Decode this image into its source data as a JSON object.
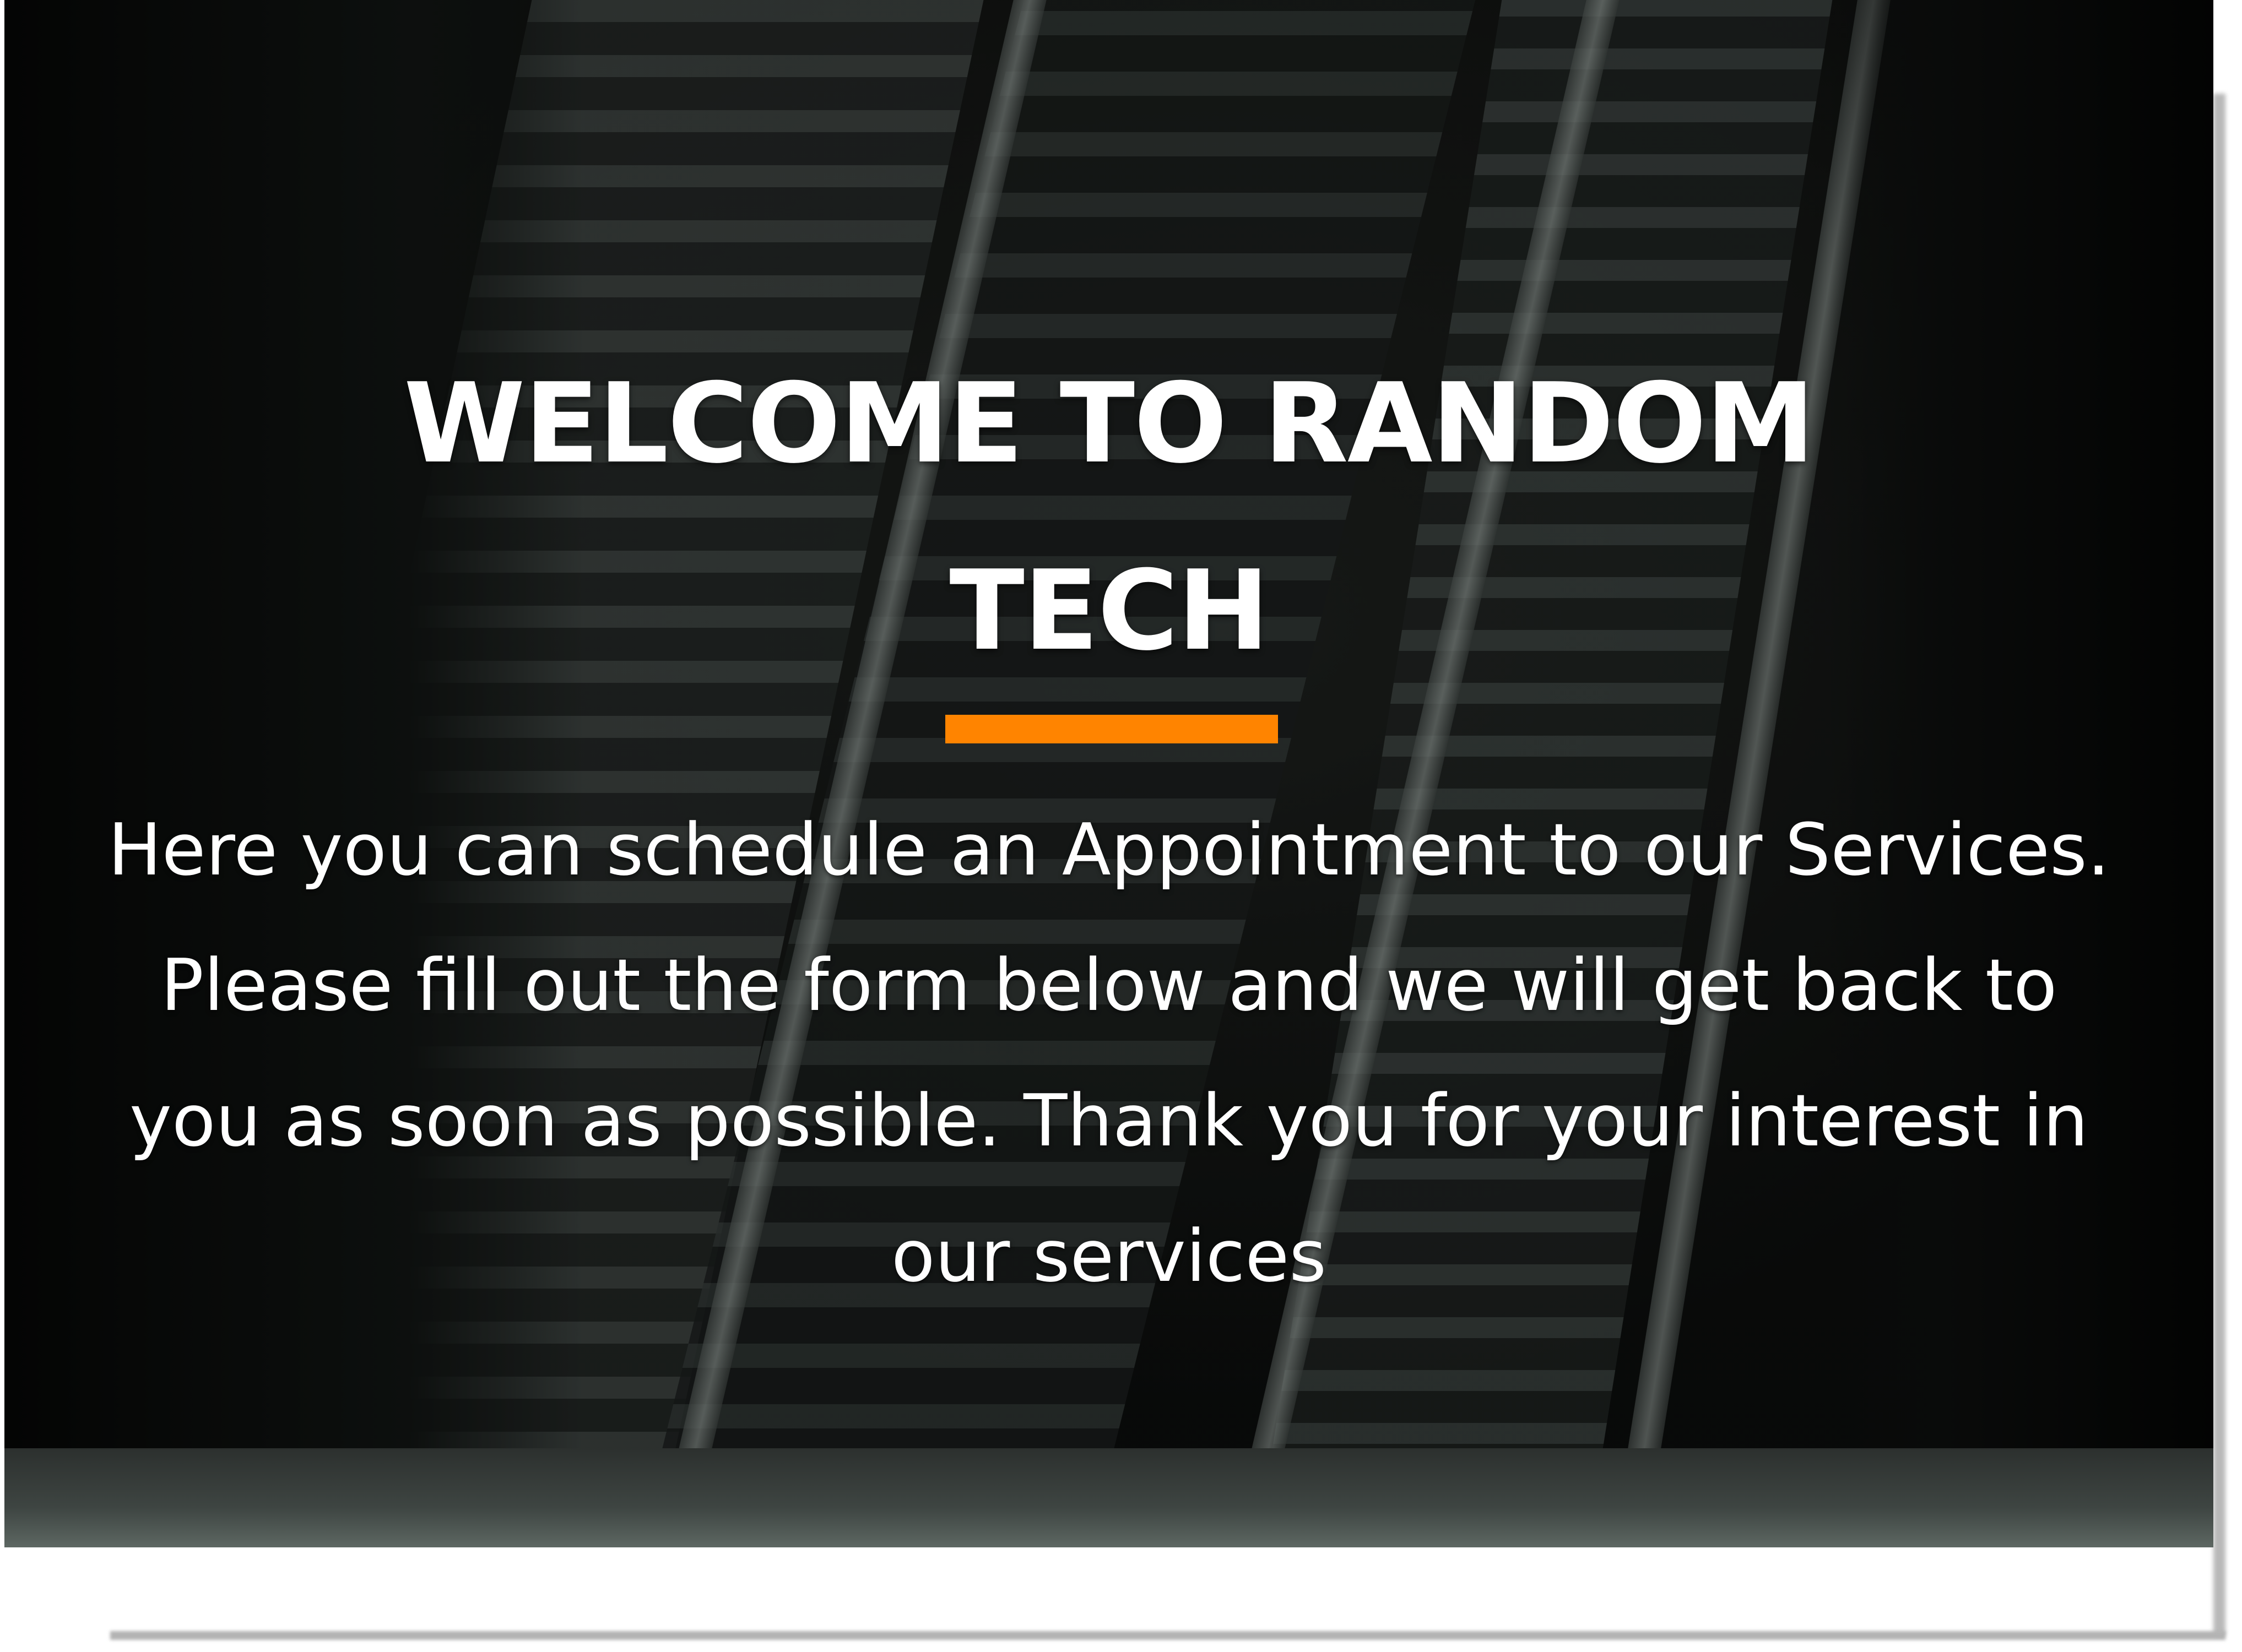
{
  "hero": {
    "title": "WELCOME TO RANDOM TECH",
    "description": "Here you can schedule an Appointment to our Services. Please fill out the form below and we will get back to you as soon as possible. Thank you for your interest in our services"
  },
  "colors": {
    "accent": "#ff8400",
    "text": "#ffffff"
  }
}
